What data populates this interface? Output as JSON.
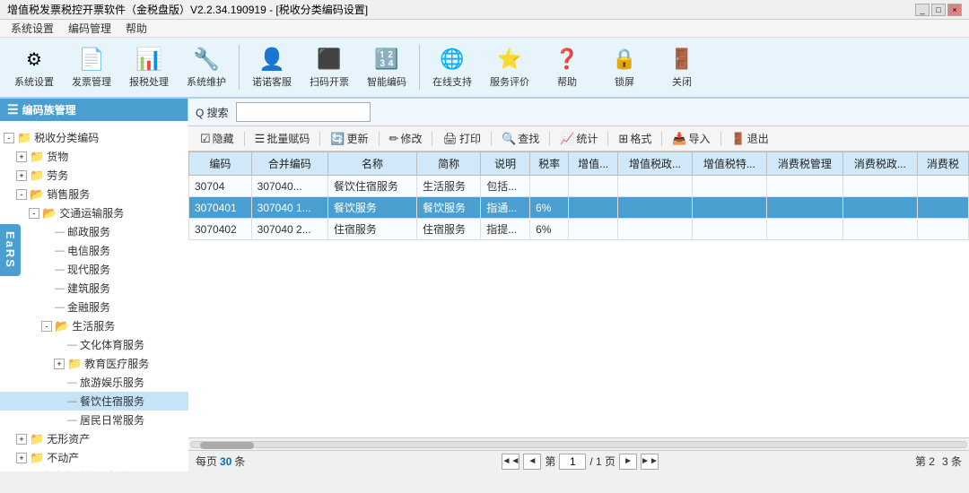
{
  "titleBar": {
    "title": "增值税发票税控开票软件（金税盘版）V2.2.34.190919 - [税收分类编码设置]",
    "buttons": [
      "_",
      "□",
      "×"
    ]
  },
  "menuBar": {
    "items": [
      "系统设置",
      "编码管理",
      "帮助"
    ]
  },
  "toolbar": {
    "buttons": [
      {
        "label": "系统设置",
        "icon": "⚙"
      },
      {
        "label": "发票管理",
        "icon": "📄"
      },
      {
        "label": "报税处理",
        "icon": "📊"
      },
      {
        "label": "系统维护",
        "icon": "🔧"
      },
      {
        "label": "诺诺客服",
        "icon": "👤"
      },
      {
        "label": "扫码开票",
        "icon": "⬛"
      },
      {
        "label": "智能编码",
        "icon": "🔢"
      },
      {
        "label": "在线支持",
        "icon": "🌐"
      },
      {
        "label": "服务评价",
        "icon": "⭐"
      },
      {
        "label": "帮助",
        "icon": "❓"
      },
      {
        "label": "锁屏",
        "icon": "🔒"
      },
      {
        "label": "关闭",
        "icon": "🚪"
      }
    ]
  },
  "panelHeader": "编码族管理",
  "searchBar": {
    "label": "Q 搜索",
    "placeholder": ""
  },
  "actionBar": {
    "buttons": [
      {
        "icon": "☑",
        "label": "隐藏"
      },
      {
        "icon": "☰",
        "label": "批量赋码"
      },
      {
        "icon": "🔄",
        "label": "更新"
      },
      {
        "icon": "✏",
        "label": "修改"
      },
      {
        "icon": "🖨",
        "label": "打印"
      },
      {
        "icon": "🔍",
        "label": "查找"
      },
      {
        "icon": "📈",
        "label": "统计"
      },
      {
        "icon": "⊞",
        "label": "格式"
      },
      {
        "icon": "📥",
        "label": "导入"
      },
      {
        "icon": "🚪",
        "label": "退出"
      }
    ]
  },
  "tree": {
    "items": [
      {
        "level": 0,
        "expand": "-",
        "folder": true,
        "label": "税收分类编码",
        "selected": false
      },
      {
        "level": 1,
        "expand": "+",
        "folder": true,
        "label": "货物",
        "selected": false
      },
      {
        "level": 1,
        "expand": "+",
        "folder": true,
        "label": "劳务",
        "selected": false
      },
      {
        "level": 1,
        "expand": "-",
        "folder": true,
        "label": "销售服务",
        "selected": false
      },
      {
        "level": 2,
        "expand": "-",
        "folder": true,
        "label": "交通运输服务",
        "selected": false
      },
      {
        "level": 3,
        "expand": null,
        "folder": false,
        "label": "邮政服务",
        "selected": false
      },
      {
        "level": 3,
        "expand": null,
        "folder": false,
        "label": "电信服务",
        "selected": false
      },
      {
        "level": 3,
        "expand": null,
        "folder": false,
        "label": "现代服务",
        "selected": false
      },
      {
        "level": 3,
        "expand": null,
        "folder": false,
        "label": "建筑服务",
        "selected": false
      },
      {
        "level": 3,
        "expand": null,
        "folder": false,
        "label": "金融服务",
        "selected": false
      },
      {
        "level": 3,
        "expand": "-",
        "folder": true,
        "label": "生活服务",
        "selected": false
      },
      {
        "level": 4,
        "expand": null,
        "folder": false,
        "label": "文化体育服务",
        "selected": false
      },
      {
        "level": 4,
        "expand": "+",
        "folder": true,
        "label": "教育医疗服务",
        "selected": false
      },
      {
        "level": 4,
        "expand": null,
        "folder": false,
        "label": "旅游娱乐服务",
        "selected": false
      },
      {
        "level": 4,
        "expand": null,
        "folder": false,
        "label": "餐饮住宿服务",
        "selected": true
      },
      {
        "level": 4,
        "expand": null,
        "folder": false,
        "label": "居民日常服务",
        "selected": false
      },
      {
        "level": 1,
        "expand": "+",
        "folder": true,
        "label": "无形资产",
        "selected": false
      },
      {
        "level": 1,
        "expand": "+",
        "folder": true,
        "label": "不动产",
        "selected": false
      },
      {
        "level": 1,
        "expand": null,
        "folder": false,
        "label": "未发生销售行为的不征税项目",
        "selected": false
      }
    ]
  },
  "tableHeaders": [
    "编码",
    "合并编码",
    "名称",
    "简称",
    "说明",
    "税率",
    "增值...",
    "增值税政...",
    "增值税特...",
    "消费税管理",
    "消费税政...",
    "消费税"
  ],
  "tableRows": [
    {
      "id": 0,
      "cells": [
        "30704",
        "307040...",
        "餐饮住宿服务",
        "生活服务",
        "包括...",
        "",
        "",
        "",
        "",
        "",
        "",
        ""
      ],
      "selected": false
    },
    {
      "id": 1,
      "cells": [
        "3070401",
        "307040 1...",
        "餐饮服务",
        "餐饮服务",
        "指通...",
        "6%",
        "",
        "",
        "",
        "",
        "",
        ""
      ],
      "selected": true
    },
    {
      "id": 2,
      "cells": [
        "3070402",
        "307040 2...",
        "住宿服务",
        "住宿服务",
        "指提...",
        "6%",
        "",
        "",
        "",
        "",
        "",
        ""
      ],
      "selected": false
    }
  ],
  "bottomBar": {
    "perPageLabel": "每页",
    "perPageNum": "30",
    "perPageUnit": "条",
    "prevBtn": "◄",
    "nextBtn": "►",
    "pageLabel": "第",
    "pageNum": "1",
    "totalLabel": "/ 1 页",
    "page2Label": "第 2",
    "page3Label": "3 条"
  },
  "sideTab": "EaRS"
}
